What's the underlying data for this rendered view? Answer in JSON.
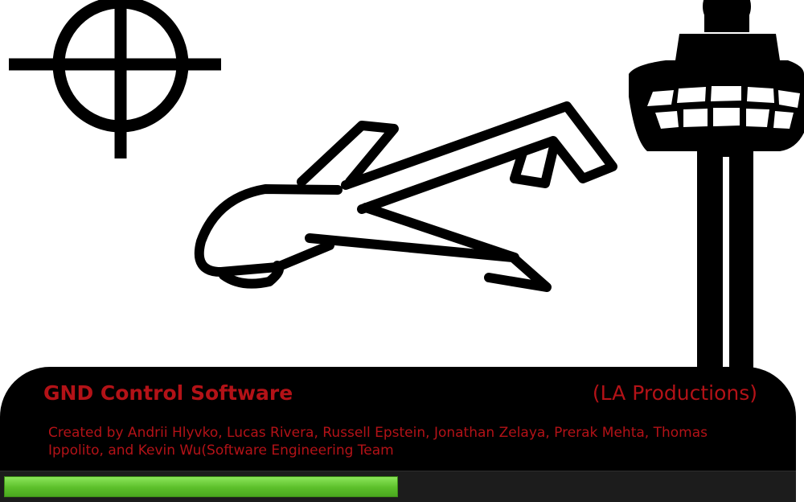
{
  "splash": {
    "title": "GND Control Software",
    "company": "(LA Productions)",
    "credits": "Created by Andrii Hlyvko, Lucas Rivera, Russell Epstein, Jonathan Zelaya, Prerak Mehta, Thomas Ippolito, and Kevin Wu(Software Engineering Team"
  },
  "progress": {
    "fraction": 0.5
  },
  "icons": [
    "crosshair-icon",
    "drone-icon",
    "control-tower-icon"
  ],
  "colors": {
    "text": "#b31217",
    "base": "#000000",
    "progress_fill": "#6fd13a",
    "progress_track": "#1c1c1c"
  }
}
